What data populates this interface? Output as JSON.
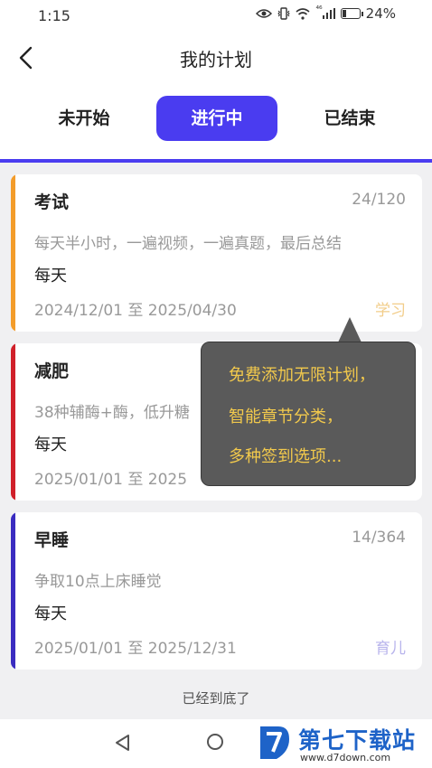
{
  "status_bar": {
    "time": "1:15",
    "network_label": "⁴⁶",
    "battery_percent": "24%",
    "battery_level": 0.24,
    "icons": [
      "eye-icon",
      "vibrate-icon",
      "wifi-icon",
      "signal-icon",
      "battery-icon"
    ]
  },
  "nav": {
    "title": "我的计划",
    "back_icon": "chevron-left-icon"
  },
  "tabs": [
    {
      "label": "未开始",
      "active": false
    },
    {
      "label": "进行中",
      "active": true
    },
    {
      "label": "已结束",
      "active": false
    }
  ],
  "colors": {
    "accent": "#4a3cf0",
    "tooltip_bg": "#5a5a5a",
    "tooltip_text": "#f2c94c"
  },
  "plans": [
    {
      "title": "考试",
      "progress": "24/120",
      "description": "每天半小时，一遍视频，一遍真题，最后总结",
      "frequency": "每天",
      "dates": "2024/12/01 至 2025/04/30",
      "category": "学习",
      "bar_color": "#f39c2a",
      "category_color": "#f2cd8a"
    },
    {
      "title": "减肥",
      "progress": "",
      "description": "38种辅酶+酶，低升糖",
      "frequency": "每天",
      "dates": "2025/01/01 至 2025",
      "category": "",
      "bar_color": "#d0202a",
      "category_color": "#999999"
    },
    {
      "title": "早睡",
      "progress": "14/364",
      "description": "争取10点上床睡觉",
      "frequency": "每天",
      "dates": "2025/01/01 至 2025/12/31",
      "category": "育儿",
      "bar_color": "#3a2cc0",
      "category_color": "#b8b4ec"
    }
  ],
  "footer": "已经到底了",
  "tooltip": {
    "lines": [
      "免费添加无限计划，",
      "智能章节分类，",
      "多种签到选项..."
    ]
  },
  "system_nav": {
    "icons": [
      "back-triangle-icon",
      "home-circle-icon"
    ]
  },
  "watermark": {
    "text": "第七下载站",
    "url": "www.d7down.com"
  }
}
